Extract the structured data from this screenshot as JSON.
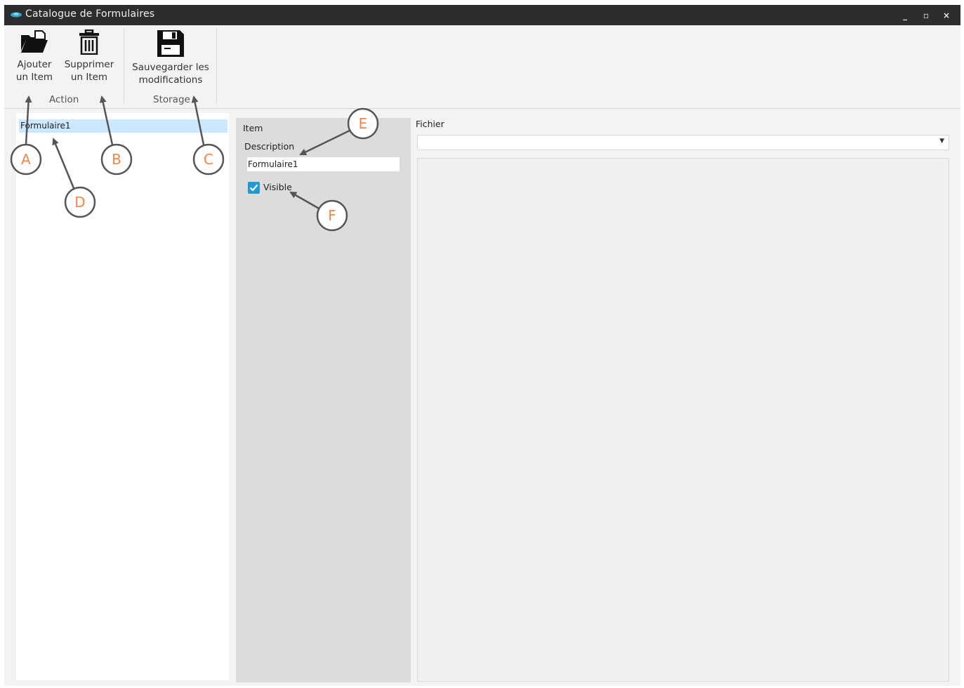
{
  "window": {
    "title": "Catalogue de Formulaires",
    "controls": {
      "minimize": "_",
      "maximize": "▫",
      "close": "×"
    }
  },
  "ribbon": {
    "add_item": {
      "line1": "Ajouter",
      "line2": "un Item",
      "icon": "open-folder-icon"
    },
    "remove_item": {
      "line1": "Supprimer",
      "line2": "un Item",
      "icon": "trash-icon"
    },
    "save_changes": {
      "line1": "Sauvegarder les",
      "line2": "modifications",
      "icon": "floppy-disk-icon"
    },
    "groups": {
      "action": "Action",
      "storage": "Storage"
    }
  },
  "list": {
    "items": [
      {
        "label": "Formulaire1",
        "selected": true
      }
    ]
  },
  "item_panel": {
    "header": "Item",
    "description_label": "Description",
    "description_value": "Formulaire1",
    "visible_label": "Visible",
    "visible_checked": true
  },
  "file_panel": {
    "label": "Fichier",
    "selected_value": ""
  },
  "annotations": {
    "callouts": [
      {
        "letter": "A"
      },
      {
        "letter": "B"
      },
      {
        "letter": "C"
      },
      {
        "letter": "D"
      },
      {
        "letter": "E"
      },
      {
        "letter": "F"
      }
    ],
    "callout_color": "#f0874b",
    "arrow_color": "#555555"
  },
  "colors": {
    "titlebar": "#2d2d30",
    "selection": "#cce8ff",
    "checkbox": "#1f9bd1"
  }
}
